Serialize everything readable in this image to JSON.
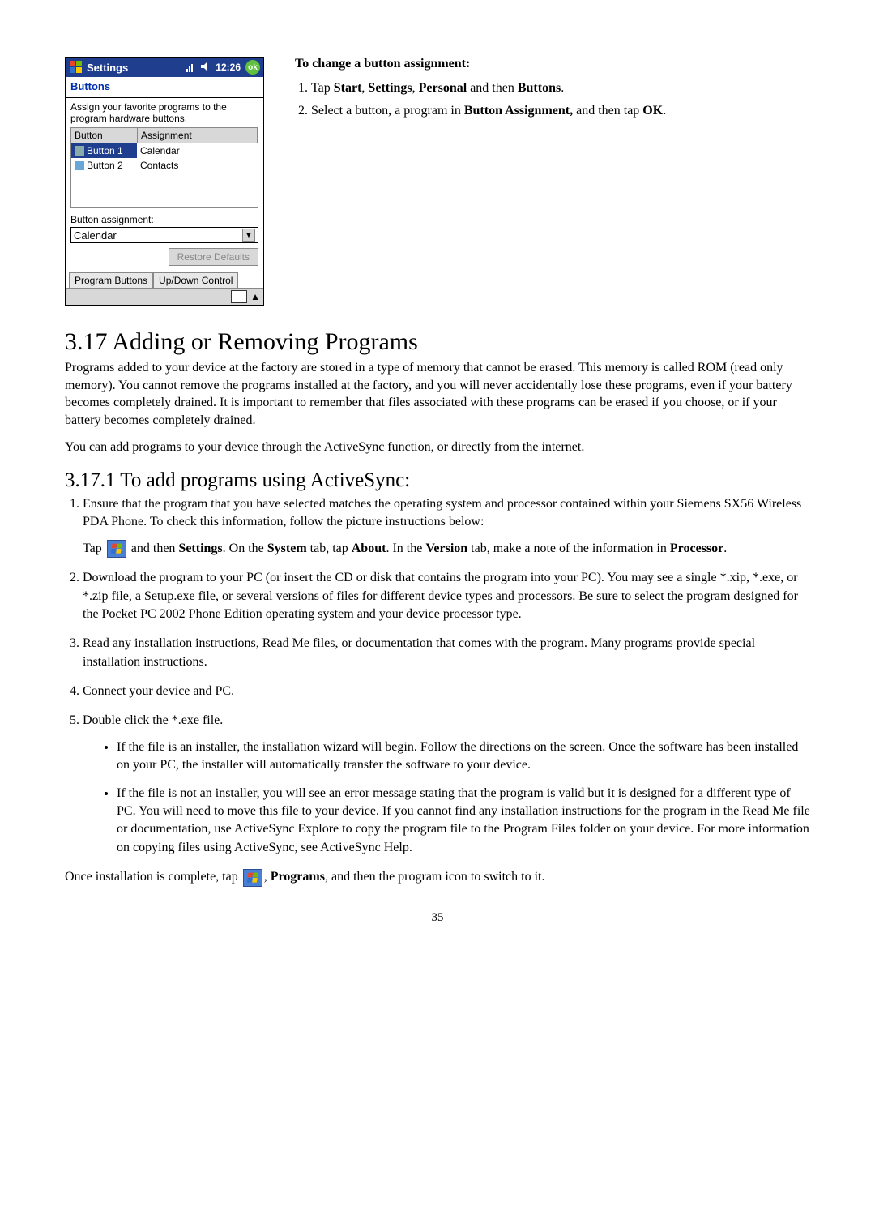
{
  "screenshot": {
    "title_app": "Settings",
    "time": "12:26",
    "ok": "ok",
    "heading": "Buttons",
    "note": "Assign your favorite programs to the program hardware buttons.",
    "columns": {
      "button": "Button",
      "assignment": "Assignment"
    },
    "rows": [
      {
        "button": "Button 1",
        "assignment": "Calendar",
        "selected": true
      },
      {
        "button": "Button 2",
        "assignment": "Contacts",
        "selected": false
      }
    ],
    "ba_label": "Button assignment:",
    "ba_value": "Calendar",
    "restore": "Restore Defaults",
    "tabs": [
      "Program Buttons",
      "Up/Down Control"
    ]
  },
  "instr": {
    "heading": "To change a button assignment:",
    "step1_pre": "Tap ",
    "step1_b1": "Start",
    "step1_m1": ", ",
    "step1_b2": "Settings",
    "step1_m2": ", ",
    "step1_b3": "Personal",
    "step1_m3": " and then ",
    "step1_b4": "Buttons",
    "step1_end": ".",
    "step2_pre": "Select a button, a program in ",
    "step2_b1": "Button Assignment,",
    "step2_m1": " and then tap ",
    "step2_b2": "OK",
    "step2_end": "."
  },
  "sec317": {
    "title": "3.17 Adding or Removing Programs",
    "p1": "Programs added to your device at the factory are stored in a type of memory that cannot be erased.  This memory is called ROM (read only memory).  You cannot remove the programs installed at the factory, and you will never accidentally lose these programs, even if your battery becomes completely drained.  It is important to remember that files associated with these programs can be erased if you choose, or if your battery becomes completely drained.",
    "p2": "You can add programs to your device through the ActiveSync function, or directly from the internet."
  },
  "sec3171": {
    "title": "3.17.1  To add programs using ActiveSync:",
    "li1": "Ensure that the program that you have selected matches the operating system and processor contained within your Siemens SX56 Wireless PDA Phone.  To check this information, follow the picture instructions below:",
    "li1b_pre": "Tap ",
    "li1b_mid1": " and then ",
    "li1b_b1": "Settings",
    "li1b_mid2": ".  On the ",
    "li1b_b2": "System",
    "li1b_mid3": " tab, tap ",
    "li1b_b3": "About",
    "li1b_mid4": ".   In the ",
    "li1b_b4": "Version",
    "li1b_mid5": " tab, make a note of the information in ",
    "li1b_b5": "Processor",
    "li1b_end": ".",
    "li2": "Download the program to your PC (or insert the CD or disk that contains the program into your PC). You may see a single *.xip,  *.exe, or *.zip file, a Setup.exe file, or several versions of files for different device types and processors. Be sure to select the program designed for the Pocket PC 2002 Phone Edition operating system and your device processor type.",
    "li3": "Read any installation instructions, Read Me files, or documentation that comes with the program. Many programs provide special installation instructions.",
    "li4": "Connect your device and PC.",
    "li5": "Double click the *.exe file.",
    "b1": "If the file is an installer, the installation wizard will begin. Follow the directions on the screen. Once the software has been installed on your PC, the installer will automatically transfer the software to your device.",
    "b2": "If the file is not an installer, you will see an error message stating that the program is valid but it is designed for a different type of PC. You will need to move this file to your device. If you cannot find any installation instructions for the program in the Read Me file or documentation, use ActiveSync Explore to copy the program file to the Program Files folder on your device. For more information on copying files using ActiveSync, see ActiveSync Help.",
    "final_pre": "Once installation is complete, tap ",
    "final_mid1": ", ",
    "final_b1": "Programs",
    "final_mid2": ", and then the program icon to switch to it."
  },
  "page_number": "35"
}
